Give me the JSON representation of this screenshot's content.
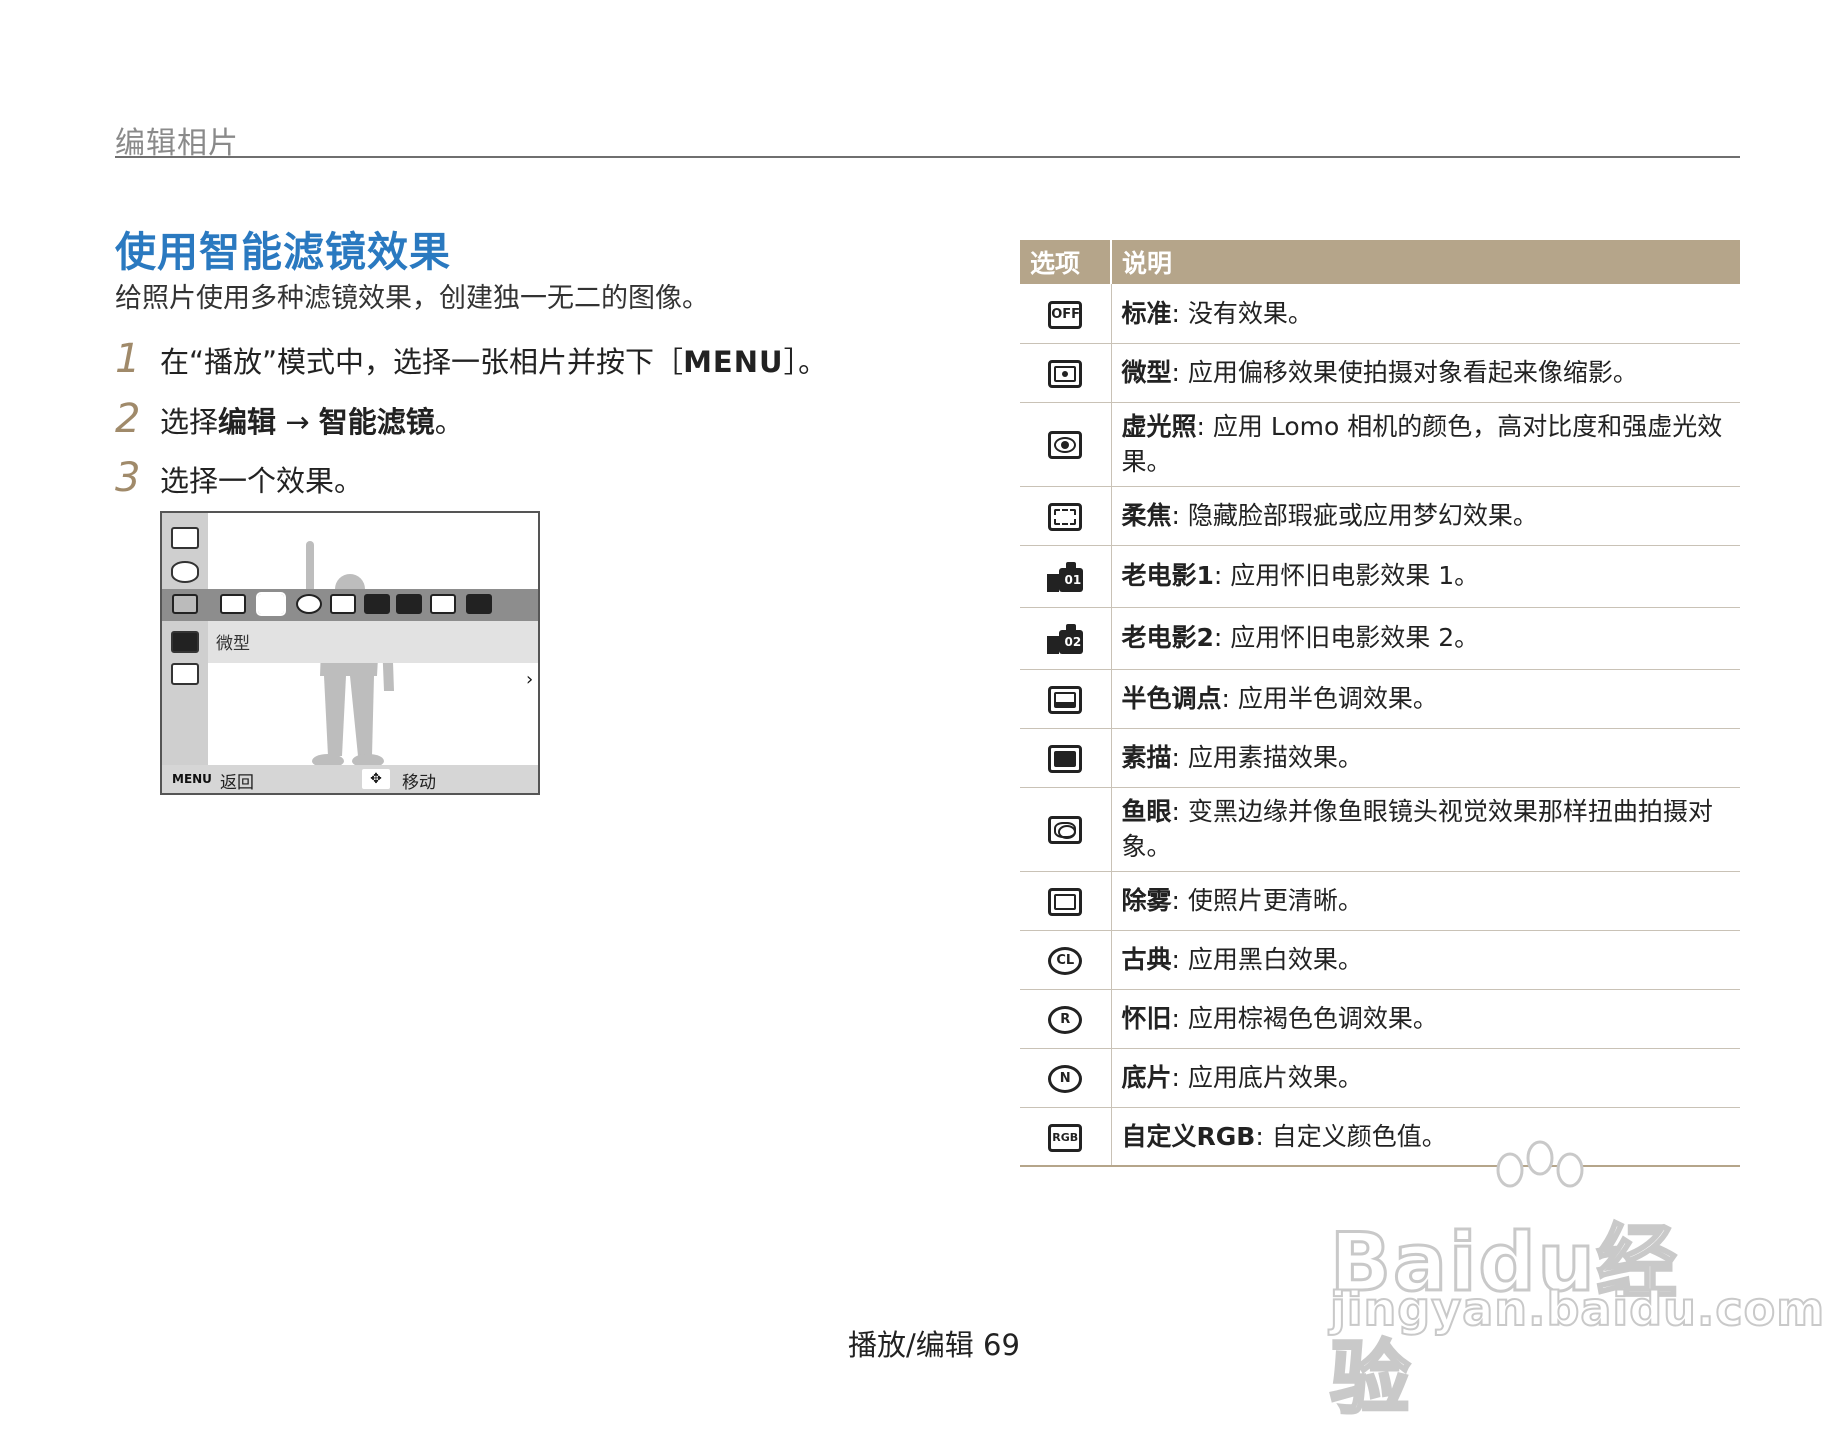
{
  "header": {
    "section": "编辑相片"
  },
  "title": "使用智能滤镜效果",
  "intro": "给照片使用多种滤镜效果，创建独一无二的图像。",
  "steps": [
    {
      "num": "1",
      "before": "在“播放”模式中，选择一张相片并按下［",
      "key": "MENU",
      "after": "］。"
    },
    {
      "num": "2",
      "before": "选择",
      "bold1": "编辑",
      "arrow": "→",
      "bold2": "智能滤镜",
      "after": "。"
    },
    {
      "num": "3",
      "text": "选择一个效果。"
    }
  ],
  "camera": {
    "selected_label": "微型",
    "menu_key": "MENU",
    "back_label": "返回",
    "move_label": "移动",
    "chevron": "›"
  },
  "table": {
    "headers": {
      "option": "选项",
      "description": "说明"
    },
    "rows": [
      {
        "icon": "standard-off-icon",
        "name": "标准",
        "sep": ": ",
        "desc": "没有效果。"
      },
      {
        "icon": "miniature-icon",
        "name": "微型",
        "sep": ": ",
        "desc": "应用偏移效果使拍摄对象看起来像缩影。"
      },
      {
        "icon": "vignetting-icon",
        "name": "虚光照",
        "sep": ": ",
        "desc": "应用 Lomo 相机的颜色，高对比度和强虚光效果。"
      },
      {
        "icon": "soft-focus-icon",
        "name": "柔焦",
        "sep": ": ",
        "desc": "隐藏脸部瑕疵或应用梦幻效果。"
      },
      {
        "icon": "old-film-1-icon",
        "name": "老电影1",
        "sep": ": ",
        "desc": "应用怀旧电影效果 1。"
      },
      {
        "icon": "old-film-2-icon",
        "name": "老电影2",
        "sep": ": ",
        "desc": "应用怀旧电影效果 2。"
      },
      {
        "icon": "halftone-dots-icon",
        "name": "半色调点",
        "sep": ": ",
        "desc": "应用半色调效果。"
      },
      {
        "icon": "sketch-icon",
        "name": "素描",
        "sep": ": ",
        "desc": "应用素描效果。"
      },
      {
        "icon": "fisheye-icon",
        "name": "鱼眼",
        "sep": ": ",
        "desc": "变黑边缘并像鱼眼镜头视觉效果那样扭曲拍摄对象。"
      },
      {
        "icon": "defog-icon",
        "name": "除雾",
        "sep": ": ",
        "desc": "使照片更清晰。"
      },
      {
        "icon": "classic-icon",
        "name": "古典",
        "sep": ": ",
        "desc": "应用黑白效果。"
      },
      {
        "icon": "retro-icon",
        "name": "怀旧",
        "sep": ": ",
        "desc": "应用棕褐色色调效果。"
      },
      {
        "icon": "negative-icon",
        "name": "底片",
        "sep": ": ",
        "desc": "应用底片效果。"
      },
      {
        "icon": "custom-rgb-icon",
        "name": "自定义RGB",
        "sep": ": ",
        "desc": "自定义颜色值。"
      }
    ]
  },
  "footer": "播放/编辑  69",
  "watermark": {
    "brand": "Baidu经验",
    "sub": "jingyan.baidu.com"
  },
  "colors": {
    "title": "#2a79c0",
    "table_header": "#b5a58a",
    "step_number": "#a08a6a"
  }
}
